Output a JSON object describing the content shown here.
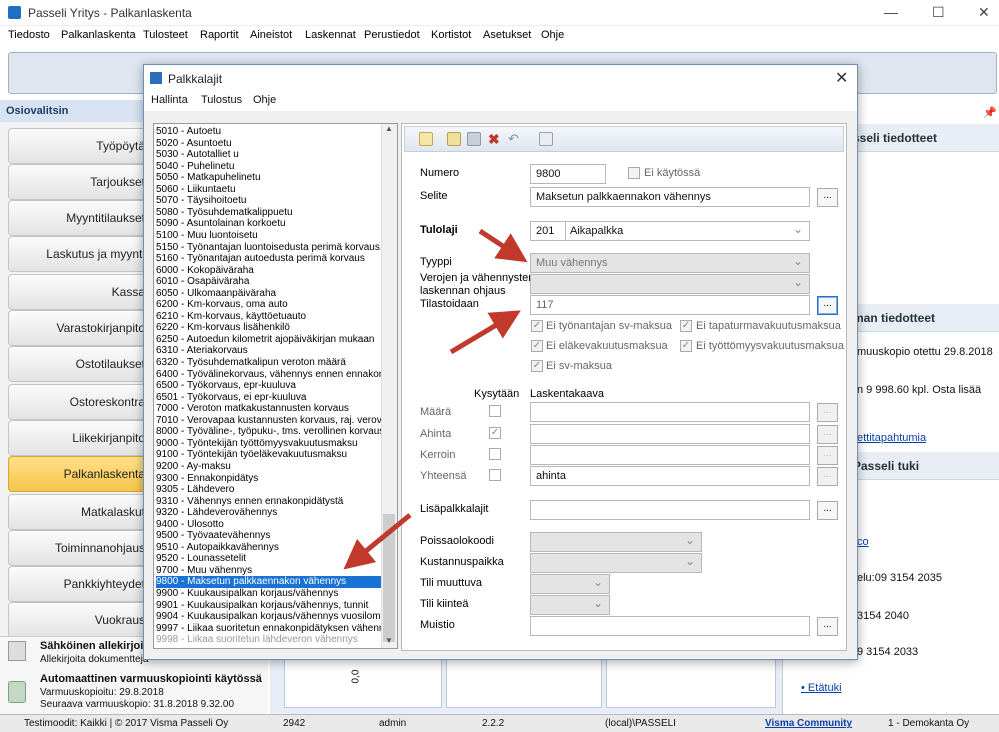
{
  "app": {
    "title": "Passeli Yritys - Palkanlaskenta"
  },
  "menu": [
    "Tiedosto",
    "Palkanlaskenta",
    "Tulosteet",
    "Raportit",
    "Aineistot",
    "Laskennat",
    "Perustiedot",
    "Kortistot",
    "Asetukset",
    "Ohje"
  ],
  "left": {
    "header": "Osiovalitsin",
    "nav": [
      "Työpöytä",
      "Tarjoukset",
      "Myyntitilaukset",
      "Laskutus ja myynti",
      "Kassa",
      "Varastokirjanpito",
      "Ostotilaukset",
      "Ostoreskontra",
      "Liikekirjanpito",
      "Palkanlaskenta",
      "Matkalaskut",
      "Toiminnanohjaus",
      "Pankkiyhteydet",
      "Vuokraus"
    ],
    "notify1_title": "Sähköinen allekirjoitus",
    "notify1_text": "Allekirjoita dokumentteja",
    "notify2_title": "Automaattinen varmuuskopiointi käytössä",
    "notify2_line1": "Varmuuskopioitu: 29.8.2018",
    "notify2_line2": "Seuraava varmuuskopio: 31.8.2018 9.32.00"
  },
  "right": {
    "h1": "sseli tiedotteet",
    "h2": "man  tiedotteet",
    "t1": "muuskopio otettu 29.8.2018",
    "t2": "n 9 998.60 kpl. Osta lisää",
    "t3": "ettitapahtumia",
    "h3": "Passeli tuki",
    "t4": "co",
    "t5": "elu:09 3154 2035",
    "t6": "3154 2040",
    "t7": "9 3154 2033",
    "t8": "Etätuki"
  },
  "midbottom": {
    "value": "0,0"
  },
  "status": {
    "left": "Testimoodit: Kaikki | © 2017 Visma Passeli Oy",
    "num": "2942",
    "user": "admin",
    "version": "2.2.2",
    "db": "(local)\\PASSELI",
    "community": "Visma Community",
    "company": "1 - Demokanta Oy"
  },
  "dialog": {
    "title": "Palkkalajit",
    "menu": [
      "Hallinta",
      "Tulostus",
      "Ohje"
    ],
    "list": [
      "5010 - Autoetu",
      "5020 - Asuntoetu",
      "5030 - Autotalliet u",
      "5040 - Puhelinetu",
      "5050 - Matkapuhelinetu",
      "5060 - Liikuntaetu",
      "5070 - Täysihoitoetu",
      "5080 - Työsuhdematkalippuetu",
      "5090 - Asuntolainan korkoetu",
      "5100 - Muu luontoisetu",
      "5150 - Työnantajan luontoisedusta perimä korvaus",
      "5160 - Työnantajan autoedusta perimä korvaus",
      "6000 - Kokopäiväraha",
      "6010 - Osapäiväraha",
      "6050 - Ulkomaanpäiväraha",
      "6200 - Km-korvaus, oma auto",
      "6210 - Km-korvaus, käyttöetuauto",
      "6220 - Km-korvaus lisähenkilö",
      "6250 - Autoedun kilometrit ajopäiväkirjan mukaan",
      "6310 - Ateriakorvaus",
      "6320 - Työsuhdematkalipun veroton määrä",
      "6400 - Työvälinekorvaus, vähennys ennen ennakonpidätystä",
      "6500 - Työkorvaus, epr-kuuluva",
      "6501 - Työkorvaus, ei epr-kuuluva",
      "7000 - Veroton matkakustannusten korvaus",
      "7010 - Verovapaa kustannusten korvaus, raj. verovelv.",
      "8000 - Työväline-, työpuku-, tms. verollinen korvaus",
      "9000 - Työntekijän työttömyysvakuutusmaksu",
      "9100 - Työntekijän työeläkevakuutusmaksu",
      "9200 - Ay-maksu",
      "9300 - Ennakonpidätys",
      "9305 - Lähdevero",
      "9310 - Vähennys ennen ennakonpidätystä",
      "9320 - Lähdeverovähennys",
      "9400 - Ulosotto",
      "9500 - Työvaatevähennys",
      "9510 - Autopaikkavähennys",
      "9520 - Lounassetelit",
      "9700 - Muu vähennys",
      "9800 - Maksetun palkkaennakon vähennys",
      "9900 - Kuukausipalkan korjaus/vähennys",
      "9901 - Kuukausipalkan korjaus/vähennys, tunnit",
      "9904 - Kuukausipalkan korjaus/vähennys vuosiloma",
      "9997 - Liikaa suoritetun ennakonpidätyksen vähennys",
      "9998 - Liikaa suoritetun lähdeveron vähennys"
    ],
    "selected_index": 39,
    "form": {
      "numero_label": "Numero",
      "numero": "9800",
      "ei_kaytossa": "Ei käytössä",
      "selite_label": "Selite",
      "selite": "Maksetun palkkaennakon vähennys",
      "tulolaji_label": "Tulolaji",
      "tulolaji_code": "201",
      "tulolaji_name": "Aikapalkka",
      "tyyppi_label": "Tyyppi",
      "tyyppi": "Muu vähennys",
      "verojen_label1": "Verojen ja vähennysten",
      "verojen_label2": "laskennan ohjaus",
      "tilastoidaan_label": "Tilastoidaan",
      "tilastoidaan": "117",
      "cb1": "Ei työnantajan sv-maksua",
      "cb2": "Ei tapaturmavakuutusmaksua",
      "cb3": "Ei eläkevakuutusmaksua",
      "cb4": "Ei työttömyysvakuutusmaksua",
      "cb5": "Ei sv-maksua",
      "kysytaan": "Kysytään",
      "laskentakaava": "Laskentakaava",
      "maara": "Määrä",
      "ahinta": "Ahinta",
      "kerroin": "Kerroin",
      "yhteensa": "Yhteensä",
      "yhteensa_val": "ahinta",
      "lisapalkkalajit": "Lisäpalkkalajit",
      "poissaolokoodi": "Poissaolokoodi",
      "kustannuspaikka": "Kustannuspaikka",
      "tili_muuttuva": "Tili muuttuva",
      "tili_kiintea": "Tili kiinteä",
      "muistio": "Muistio",
      "dots": "..."
    }
  }
}
